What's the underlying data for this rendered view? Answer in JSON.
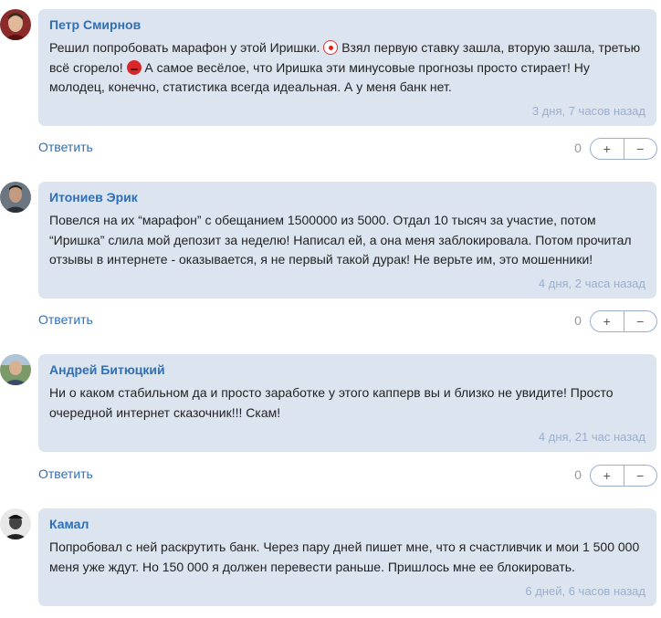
{
  "comments": [
    {
      "author": "Петр Смирнов",
      "text_parts": [
        "Решил попробовать марафон у этой Иришки. ",
        " Взял первую ставку зашла, вторую зашла, третью всё сгорело! ",
        " А самое весёлое, что Иришка эти минусовые прогнозы просто стирает! Ну молодец, конечно, статистика всегда идеальная. А у меня банк нет."
      ],
      "emojis": [
        "clown-face-icon",
        "angry-face-icon"
      ],
      "time": "3 дня, 7 часов назад",
      "votes": "0"
    },
    {
      "author": "Итониев Эрик",
      "text": "Повелся на их “марафон” с обещанием 1500000 из 5000. Отдал 10 тысяч за участие, потом “Иришка” слила мой депозит за неделю! Написал ей, а она меня заблокировала. Потом прочитал отзывы в интернете - оказывается, я не первый такой дурак! Не верьте им, это мошенники!",
      "time": "4 дня, 2 часа назад",
      "votes": "0"
    },
    {
      "author": "Андрей Битюцкий",
      "text": "Ни о каком стабильном да и просто заработке у этого капперв вы и близко не увидите! Просто очередной интернет сказочник!!! Скам!",
      "time": "4 дня, 21 час назад",
      "votes": "0"
    },
    {
      "author": "Камал",
      "text": "Попробовал с ней раскрутить банк. Через пару дней пишет мне, что я счастливчик и мои 1 500 000 меня уже ждут. Но 150 000 я должен перевести раньше. Пришлось мне ее блокировать.",
      "time": "6 дней, 6 часов назад"
    }
  ],
  "ui": {
    "reply_label": "Ответить",
    "upvote_label": "+",
    "downvote_label": "−"
  }
}
